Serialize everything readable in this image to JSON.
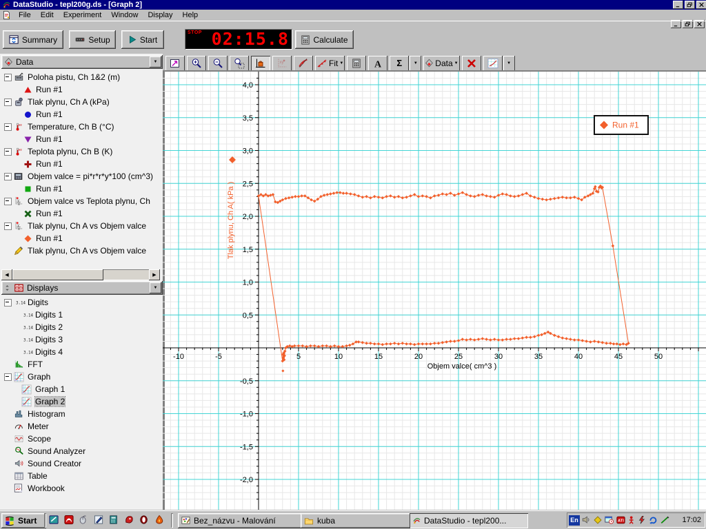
{
  "window": {
    "title": "DataStudio - tepl200g.ds - [Graph 2]"
  },
  "menu": {
    "items": [
      "File",
      "Edit",
      "Experiment",
      "Window",
      "Display",
      "Help"
    ]
  },
  "toolbar": {
    "summary_label": "Summary",
    "setup_label": "Setup",
    "start_label": "Start",
    "calculate_label": "Calculate",
    "timer": {
      "status": "STOP",
      "value": "02:15.8"
    }
  },
  "graph_toolbar": {
    "buttons": [
      {
        "name": "scale-to-fit"
      },
      {
        "name": "zoom-in"
      },
      {
        "name": "zoom-out"
      },
      {
        "name": "zoom-select"
      },
      {
        "name": "smart-tool",
        "pressed": true
      },
      {
        "name": "xy-tool",
        "disabled": true
      },
      {
        "name": "slope-tool"
      },
      {
        "name": "fit-menu",
        "label": "Fit",
        "dropdown": true
      },
      {
        "name": "calculate-tool"
      },
      {
        "name": "text-annotation"
      },
      {
        "name": "statistics",
        "label": "Σ",
        "dropdown": "split"
      },
      {
        "name": "data-menu",
        "label": "Data",
        "dropdown": true
      },
      {
        "name": "delete-tool"
      },
      {
        "name": "graph-settings",
        "dropdown": "split"
      }
    ]
  },
  "data_panel": {
    "header": "Data",
    "items": [
      {
        "label": "Poloha pistu, Ch 1&2 (m)",
        "icon": "position-sensor-icon",
        "runs": [
          {
            "label": "Run #1",
            "marker": "triangle-up",
            "color": "#dd1414"
          }
        ]
      },
      {
        "label": "Tlak plynu, Ch A (kPa)",
        "icon": "pressure-sensor-icon",
        "runs": [
          {
            "label": "Run #1",
            "marker": "circle",
            "color": "#1414cc"
          }
        ]
      },
      {
        "label": "Temperature, Ch B (°C)",
        "icon": "thermometer-icon",
        "runs": [
          {
            "label": "Run #1",
            "marker": "triangle-down",
            "color": "#8822aa"
          }
        ]
      },
      {
        "label": "Teplota plynu, Ch B (K)",
        "icon": "thermometer-icon",
        "runs": [
          {
            "label": "Run #1",
            "marker": "plus",
            "color": "#a01212"
          }
        ]
      },
      {
        "label": "Objem valce = pi*r*r*y*100 (cm^3)",
        "icon": "calculator-icon",
        "runs": [
          {
            "label": "Run #1",
            "marker": "square",
            "color": "#12a812"
          }
        ]
      },
      {
        "label": "Objem valce vs Teplota plynu, Ch",
        "icon": "yx-plot-icon",
        "runs": [
          {
            "label": "Run #1",
            "marker": "xcross",
            "color": "#156015"
          }
        ]
      },
      {
        "label": "Tlak plynu, Ch A vs Objem valce",
        "icon": "yx-plot-icon",
        "runs": [
          {
            "label": "Run #1",
            "marker": "diamond",
            "color": "#f2602c"
          }
        ]
      },
      {
        "label": "Tlak plynu, Ch A vs Objem valce",
        "icon": "pencil-icon",
        "runs": []
      }
    ]
  },
  "displays_panel": {
    "header": "Displays",
    "items": [
      {
        "label": "Digits",
        "icon": "digits-icon",
        "children": [
          "Digits 1",
          "Digits 2",
          "Digits 3",
          "Digits 4"
        ]
      },
      {
        "label": "FFT",
        "icon": "fft-icon"
      },
      {
        "label": "Graph",
        "icon": "graph-display-icon",
        "children": [
          "Graph 1",
          "Graph 2"
        ],
        "selected_child": "Graph 2"
      },
      {
        "label": "Histogram",
        "icon": "histogram-icon"
      },
      {
        "label": "Meter",
        "icon": "meter-icon"
      },
      {
        "label": "Scope",
        "icon": "scope-icon"
      },
      {
        "label": "Sound Analyzer",
        "icon": "sound-analyzer-icon"
      },
      {
        "label": "Sound Creator",
        "icon": "sound-creator-icon"
      },
      {
        "label": "Table",
        "icon": "table-icon"
      },
      {
        "label": "Workbook",
        "icon": "workbook-icon"
      }
    ]
  },
  "chart_data": {
    "type": "scatter",
    "title": "",
    "xlabel": "Objem valce( cm^3 )",
    "ylabel": "Tlak plynu, Ch A( kPa )",
    "xlim": [
      -11.9,
      55.9
    ],
    "ylim": [
      -2.4,
      4.2
    ],
    "grid": {
      "x_major_step": 5,
      "x_minor_step": 1,
      "y_major_step": 0.5,
      "y_minor_step": 0.1,
      "major_color": "#42d4d4",
      "minor_color": "#e7e7e7"
    },
    "x_tick_values": [
      -10,
      -5,
      5,
      10,
      15,
      20,
      25,
      30,
      35,
      40,
      45,
      50
    ],
    "x_tick_labels": [
      "-10",
      "-5",
      "5",
      "10",
      "15",
      "20",
      "25",
      "30",
      "35",
      "40",
      "45",
      "50"
    ],
    "y_tick_values": [
      4,
      3.5,
      3,
      2.5,
      2,
      1.5,
      1,
      0.5,
      -0.5,
      -1,
      -1.5,
      -2
    ],
    "y_tick_labels": [
      "4,0",
      "3,5",
      "3,0",
      "2,5",
      "2,0",
      "1,5",
      "1,0",
      "0,5",
      "-0,5",
      "-1,0",
      "-1,5",
      "-2,0"
    ],
    "legend": {
      "label": "Run #1",
      "marker": "diamond",
      "position": "top-right"
    },
    "series": [
      {
        "name": "Run #1",
        "color": "#f2602c",
        "marker": "diamond",
        "closed": true,
        "points": [
          [
            0.0,
            2.31
          ],
          [
            0.3,
            2.33
          ],
          [
            0.6,
            2.31
          ],
          [
            0.9,
            2.33
          ],
          [
            1.2,
            2.31
          ],
          [
            1.5,
            2.32
          ],
          [
            1.8,
            2.33
          ],
          [
            2.1,
            2.22
          ],
          [
            2.4,
            2.21
          ],
          [
            2.7,
            2.23
          ],
          [
            3.0,
            2.25
          ],
          [
            3.4,
            2.27
          ],
          [
            3.8,
            2.28
          ],
          [
            4.2,
            2.29
          ],
          [
            4.6,
            2.3
          ],
          [
            5.0,
            2.3
          ],
          [
            5.4,
            2.31
          ],
          [
            5.8,
            2.31
          ],
          [
            6.2,
            2.28
          ],
          [
            6.6,
            2.25
          ],
          [
            7.0,
            2.23
          ],
          [
            7.4,
            2.26
          ],
          [
            7.8,
            2.3
          ],
          [
            8.2,
            2.32
          ],
          [
            8.6,
            2.33
          ],
          [
            9.0,
            2.34
          ],
          [
            9.4,
            2.35
          ],
          [
            9.8,
            2.36
          ],
          [
            10.2,
            2.36
          ],
          [
            10.6,
            2.35
          ],
          [
            11.0,
            2.35
          ],
          [
            11.5,
            2.34
          ],
          [
            12.0,
            2.33
          ],
          [
            12.5,
            2.31
          ],
          [
            13.0,
            2.29
          ],
          [
            13.5,
            2.3
          ],
          [
            14.0,
            2.28
          ],
          [
            14.5,
            2.3
          ],
          [
            15.0,
            2.29
          ],
          [
            15.5,
            2.28
          ],
          [
            16.0,
            2.3
          ],
          [
            16.5,
            2.31
          ],
          [
            17.0,
            2.29
          ],
          [
            17.5,
            2.3
          ],
          [
            18.0,
            2.28
          ],
          [
            18.5,
            2.29
          ],
          [
            19.0,
            2.31
          ],
          [
            19.5,
            2.33
          ],
          [
            20.0,
            2.3
          ],
          [
            20.5,
            2.31
          ],
          [
            21.0,
            2.3
          ],
          [
            21.5,
            2.28
          ],
          [
            22.0,
            2.31
          ],
          [
            22.5,
            2.32
          ],
          [
            23.0,
            2.34
          ],
          [
            23.5,
            2.33
          ],
          [
            24.0,
            2.35
          ],
          [
            24.5,
            2.32
          ],
          [
            25.0,
            2.34
          ],
          [
            25.5,
            2.36
          ],
          [
            26.0,
            2.33
          ],
          [
            26.5,
            2.31
          ],
          [
            27.0,
            2.3
          ],
          [
            27.5,
            2.32
          ],
          [
            28.0,
            2.33
          ],
          [
            28.5,
            2.31
          ],
          [
            29.0,
            2.3
          ],
          [
            29.5,
            2.29
          ],
          [
            30.0,
            2.32
          ],
          [
            30.5,
            2.34
          ],
          [
            31.0,
            2.33
          ],
          [
            31.5,
            2.31
          ],
          [
            32.0,
            2.3
          ],
          [
            32.5,
            2.31
          ],
          [
            33.0,
            2.33
          ],
          [
            33.5,
            2.35
          ],
          [
            34.0,
            2.31
          ],
          [
            34.5,
            2.29
          ],
          [
            35.0,
            2.27
          ],
          [
            35.5,
            2.26
          ],
          [
            36.0,
            2.25
          ],
          [
            36.5,
            2.26
          ],
          [
            37.0,
            2.27
          ],
          [
            37.5,
            2.28
          ],
          [
            38.0,
            2.29
          ],
          [
            38.5,
            2.28
          ],
          [
            39.0,
            2.28
          ],
          [
            39.5,
            2.29
          ],
          [
            40.0,
            2.27
          ],
          [
            40.4,
            2.25
          ],
          [
            40.8,
            2.29
          ],
          [
            41.2,
            2.31
          ],
          [
            41.5,
            2.33
          ],
          [
            41.8,
            2.35
          ],
          [
            42.0,
            2.42
          ],
          [
            42.1,
            2.45
          ],
          [
            42.25,
            2.38
          ],
          [
            42.45,
            2.37
          ],
          [
            42.6,
            2.44
          ],
          [
            42.75,
            2.46
          ],
          [
            42.9,
            2.43
          ],
          [
            43.0,
            2.44
          ],
          [
            44.3,
            1.55
          ],
          [
            46.25,
            0.07
          ],
          [
            46.0,
            0.05
          ],
          [
            45.6,
            0.06
          ],
          [
            45.2,
            0.05
          ],
          [
            44.8,
            0.06
          ],
          [
            44.4,
            0.06
          ],
          [
            44.0,
            0.07
          ],
          [
            43.5,
            0.07
          ],
          [
            43.0,
            0.08
          ],
          [
            42.5,
            0.09
          ],
          [
            42.0,
            0.1
          ],
          [
            41.5,
            0.09
          ],
          [
            41.0,
            0.1
          ],
          [
            40.5,
            0.11
          ],
          [
            40.0,
            0.12
          ],
          [
            39.5,
            0.12
          ],
          [
            39.0,
            0.13
          ],
          [
            38.5,
            0.14
          ],
          [
            38.0,
            0.15
          ],
          [
            37.5,
            0.17
          ],
          [
            37.0,
            0.19
          ],
          [
            36.5,
            0.22
          ],
          [
            36.2,
            0.24
          ],
          [
            35.8,
            0.22
          ],
          [
            35.4,
            0.2
          ],
          [
            35.0,
            0.19
          ],
          [
            34.5,
            0.17
          ],
          [
            34.0,
            0.16
          ],
          [
            33.5,
            0.16
          ],
          [
            33.0,
            0.15
          ],
          [
            32.5,
            0.14
          ],
          [
            32.0,
            0.14
          ],
          [
            31.5,
            0.13
          ],
          [
            31.0,
            0.13
          ],
          [
            30.5,
            0.12
          ],
          [
            30.0,
            0.12
          ],
          [
            29.5,
            0.13
          ],
          [
            29.0,
            0.12
          ],
          [
            28.5,
            0.13
          ],
          [
            28.0,
            0.14
          ],
          [
            27.5,
            0.13
          ],
          [
            27.0,
            0.12
          ],
          [
            26.5,
            0.13
          ],
          [
            26.0,
            0.12
          ],
          [
            25.5,
            0.13
          ],
          [
            25.0,
            0.11
          ],
          [
            24.5,
            0.1
          ],
          [
            24.0,
            0.1
          ],
          [
            23.5,
            0.09
          ],
          [
            23.0,
            0.08
          ],
          [
            22.5,
            0.07
          ],
          [
            22.0,
            0.07
          ],
          [
            21.5,
            0.06
          ],
          [
            21.0,
            0.06
          ],
          [
            20.5,
            0.06
          ],
          [
            20.0,
            0.06
          ],
          [
            19.5,
            0.05
          ],
          [
            19.0,
            0.06
          ],
          [
            18.5,
            0.06
          ],
          [
            18.0,
            0.07
          ],
          [
            17.5,
            0.06
          ],
          [
            17.0,
            0.07
          ],
          [
            16.5,
            0.06
          ],
          [
            16.0,
            0.06
          ],
          [
            15.5,
            0.05
          ],
          [
            15.0,
            0.06
          ],
          [
            14.5,
            0.06
          ],
          [
            14.0,
            0.07
          ],
          [
            13.5,
            0.07
          ],
          [
            13.0,
            0.08
          ],
          [
            12.5,
            0.09
          ],
          [
            12.2,
            0.09
          ],
          [
            11.8,
            0.06
          ],
          [
            11.4,
            0.04
          ],
          [
            11.0,
            0.03
          ],
          [
            10.5,
            0.02
          ],
          [
            10.0,
            0.02
          ],
          [
            9.5,
            0.03
          ],
          [
            9.0,
            0.02
          ],
          [
            8.5,
            0.03
          ],
          [
            8.0,
            0.03
          ],
          [
            7.5,
            0.02
          ],
          [
            7.0,
            0.03
          ],
          [
            6.5,
            0.03
          ],
          [
            6.0,
            0.02
          ],
          [
            5.5,
            0.03
          ],
          [
            5.0,
            0.03
          ],
          [
            4.5,
            0.03
          ],
          [
            4.2,
            0.02
          ],
          [
            3.9,
            0.03
          ],
          [
            3.6,
            0.02
          ],
          [
            3.4,
            0.0
          ],
          [
            3.3,
            -0.05
          ],
          [
            3.25,
            -0.12
          ],
          [
            3.2,
            -0.18
          ],
          [
            3.15,
            -0.08
          ],
          [
            3.1,
            -0.15
          ],
          [
            3.05,
            -0.1
          ],
          [
            3.0,
            -0.2
          ]
        ],
        "outliers": [
          [
            3.05,
            -0.35
          ]
        ]
      }
    ]
  },
  "taskbar": {
    "start_label": "Start",
    "tasks": [
      {
        "label": "Bez_názvu - Malování",
        "icon": "paint-icon"
      },
      {
        "label": "kuba",
        "icon": "folder-icon"
      },
      {
        "label": "DataStudio - tepl200...",
        "icon": "datastudio-icon",
        "active": true
      }
    ],
    "tray": {
      "language": "En",
      "time": "17:02"
    }
  }
}
